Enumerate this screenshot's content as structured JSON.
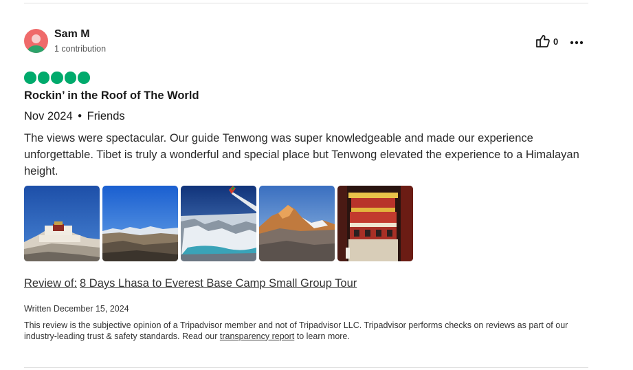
{
  "user": {
    "name": "Sam M",
    "contributions": "1 contribution"
  },
  "helpful": {
    "count": "0",
    "icon": "thumbs-up-icon"
  },
  "more_icon": "ellipsis-icon",
  "review": {
    "rating": 5,
    "rating_color": "#00aa6c",
    "title": "Rockin’ in the Roof of The World",
    "date": "Nov 2024",
    "separator": "•",
    "trip_type": "Friends",
    "text": "The views were spectacular. Our guide Tenwong was super knowledgeable and made our experience unforgettable. Tibet is truly a wonderful and special place but Tenwong elevated the experience to a Himalayan height.",
    "photos": [
      "potala-palace-photo",
      "tibetan-plateau-photo",
      "airplane-wing-mountains-photo",
      "everest-peak-photo",
      "monastery-building-photo"
    ],
    "review_of_label": "Review of:",
    "review_of_link": "8 Days Lhasa to Everest Base Camp Small Group Tour",
    "written": "Written December 15, 2024"
  },
  "disclaimer": {
    "text_before": "This review is the subjective opinion of a Tripadvisor member and not of Tripadvisor LLC. Tripadvisor performs checks on reviews as part of our industry-leading trust & safety standards. Read our ",
    "link": "transparency report",
    "text_after": " to learn more."
  }
}
